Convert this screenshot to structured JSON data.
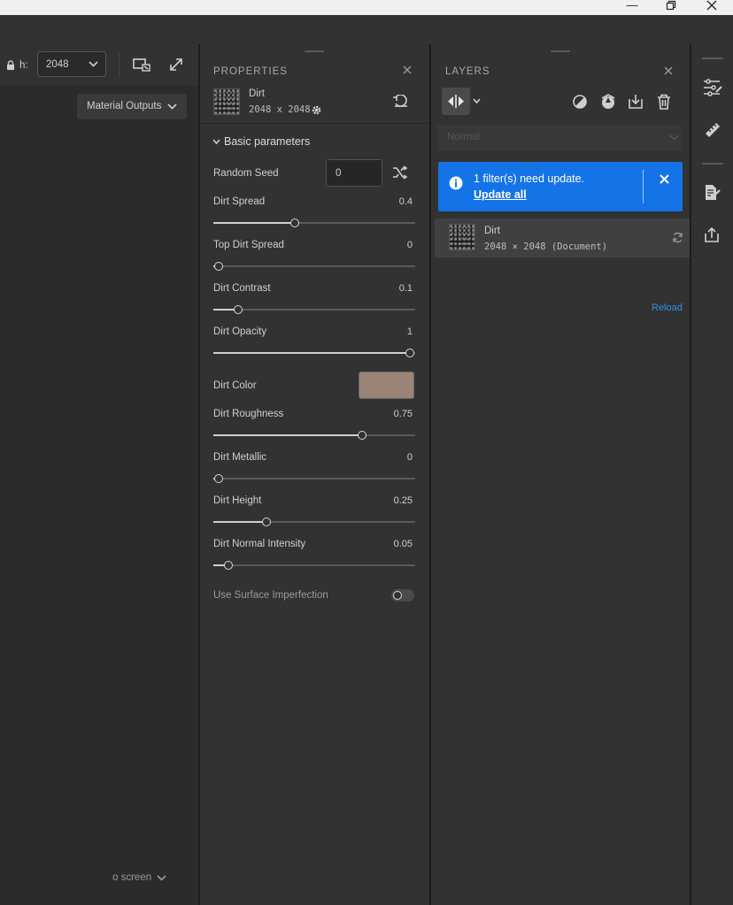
{
  "viewport": {
    "size_label": "h:",
    "size_value": "2048",
    "material_outputs": "Material Outputs",
    "bottom_dropdown": "o screen"
  },
  "properties": {
    "title": "PROPERTIES",
    "item_name": "Dirt",
    "item_size": "2048 x 2048",
    "section": "Basic parameters",
    "random_seed_label": "Random Seed",
    "random_seed_value": "0",
    "sliders": [
      {
        "label": "Dirt Spread",
        "value": "0.4",
        "fraction": 0.4
      },
      {
        "label": "Top Dirt Spread",
        "value": "0",
        "fraction": 0
      },
      {
        "label": "Dirt Contrast",
        "value": "0.1",
        "fraction": 0.1
      },
      {
        "label": "Dirt Opacity",
        "value": "1",
        "fraction": 1
      },
      {
        "label": "Dirt Roughness",
        "value": "0.75",
        "fraction": 0.75
      },
      {
        "label": "Dirt Metallic",
        "value": "0",
        "fraction": 0
      },
      {
        "label": "Dirt Height",
        "value": "0.25",
        "fraction": 0.25
      },
      {
        "label": "Dirt Normal Intensity",
        "value": "0.05",
        "fraction": 0.05
      }
    ],
    "color_label": "Dirt Color",
    "color_value": "#9a8478",
    "surface_label": "Use Surface Imperfection",
    "surface_toggle": "off"
  },
  "layers": {
    "title": "LAYERS",
    "blend_mode": "Normal",
    "notice_text": "1 filter(s) need update.",
    "notice_link": "Update all",
    "layer_name": "Dirt",
    "layer_info": "2048 × 2048 (Document)",
    "reload": "Reload"
  },
  "colors": {
    "accent": "#1473e6",
    "link": "#378ef0"
  }
}
